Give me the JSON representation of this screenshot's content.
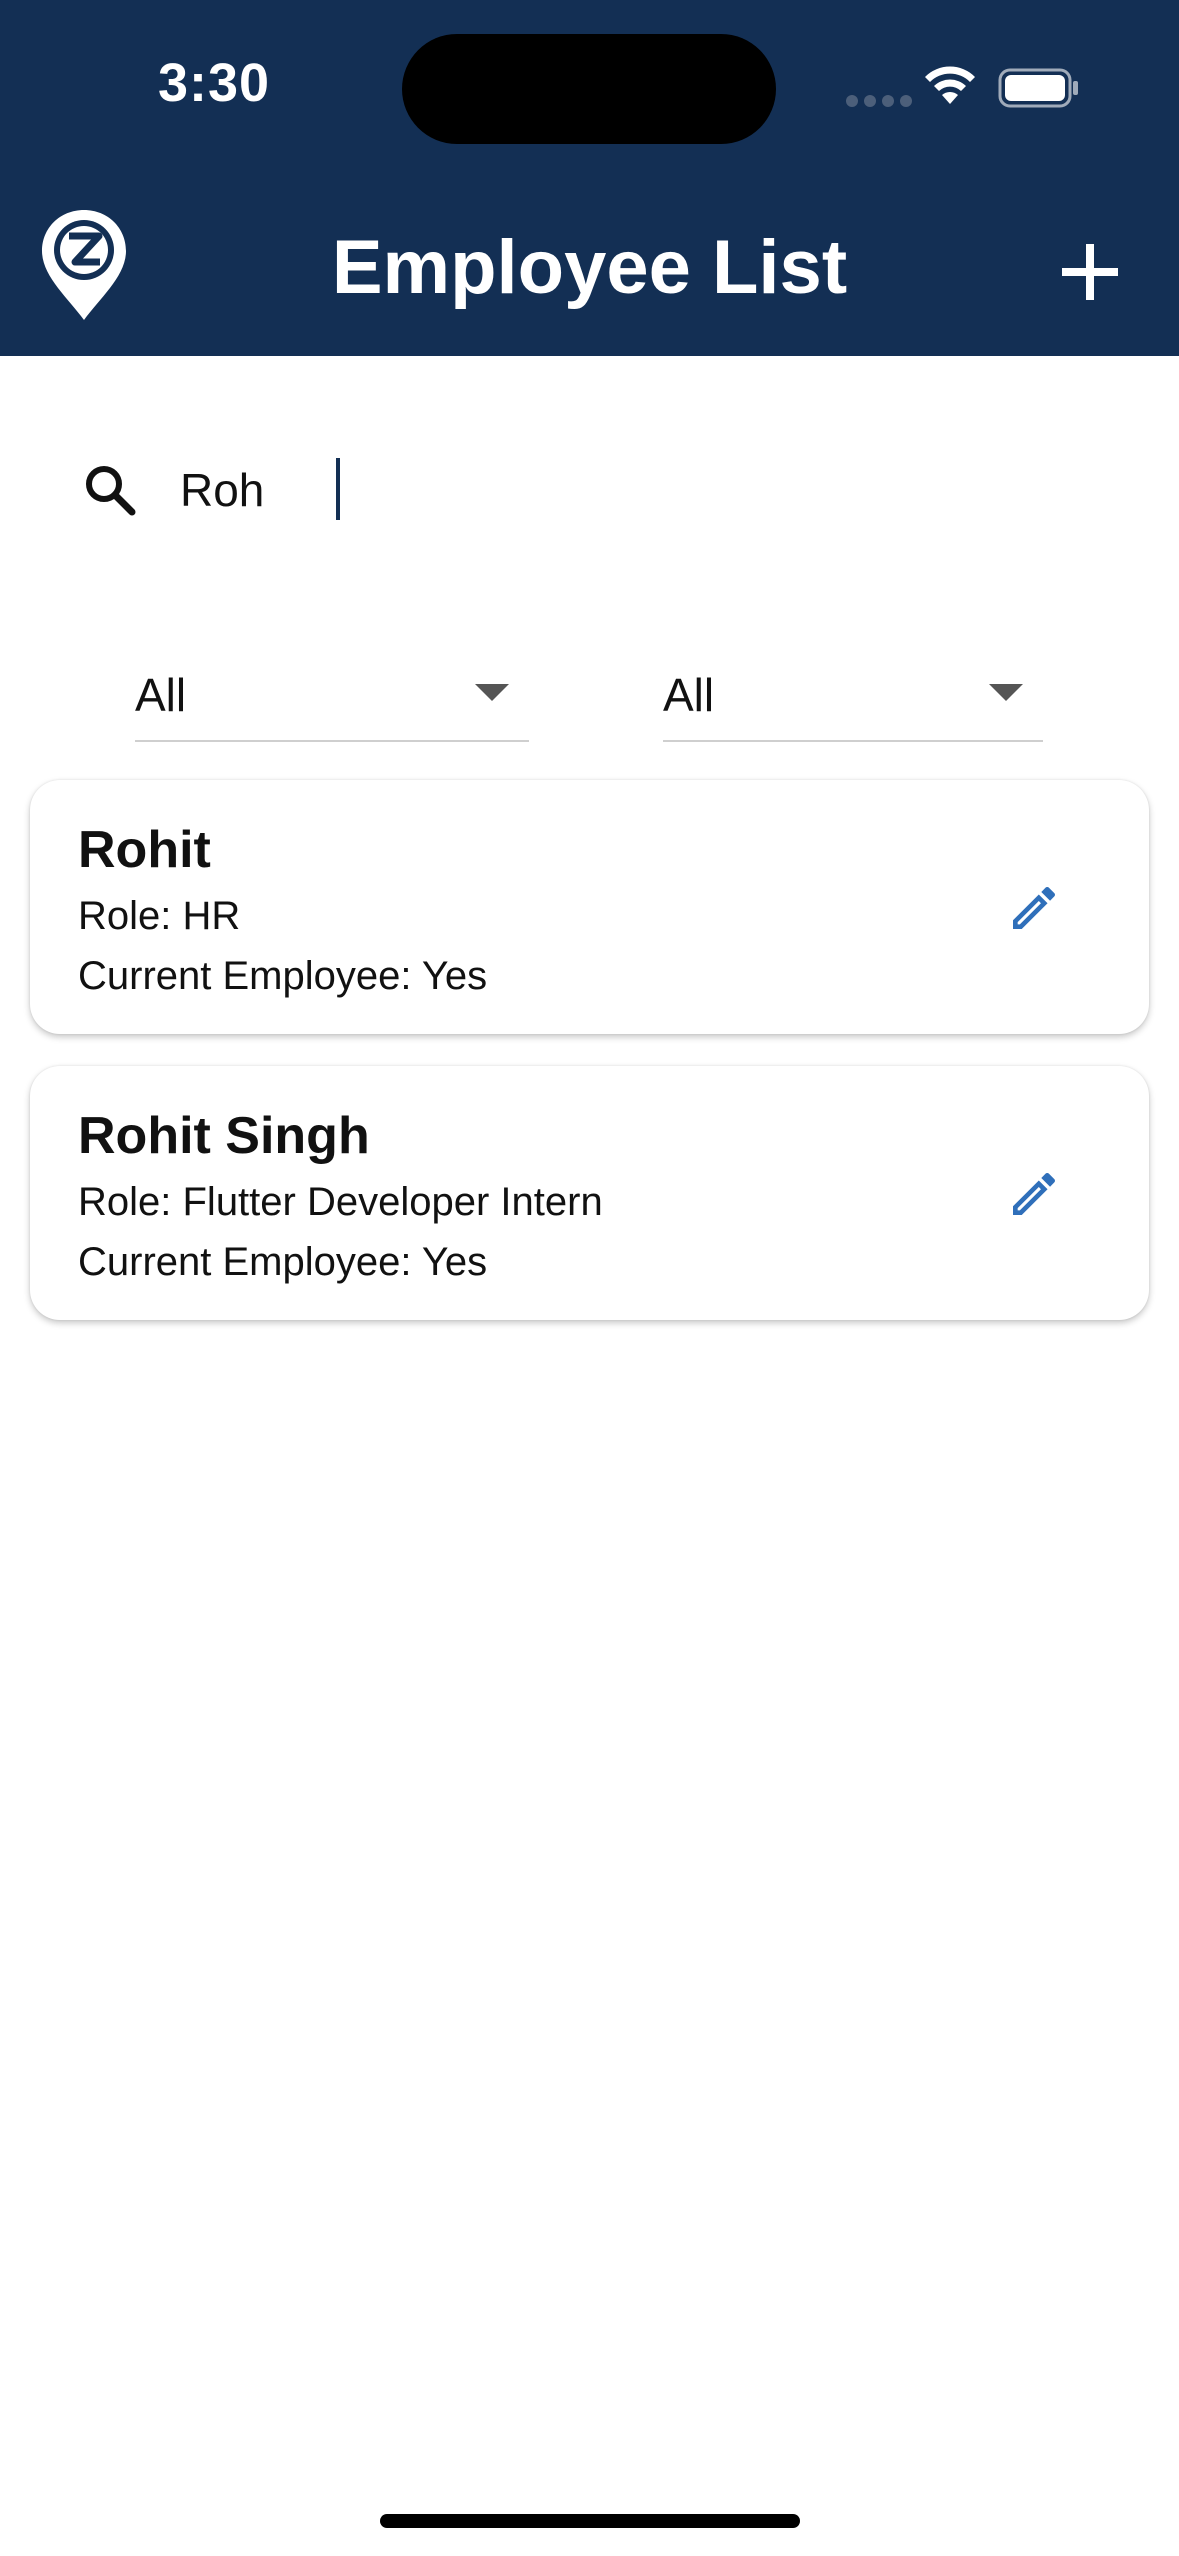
{
  "status_bar": {
    "time": "3:30"
  },
  "app_bar": {
    "title": "Employee List",
    "logo_icon": "location-pin-z-logo",
    "add_icon": "plus-icon"
  },
  "search": {
    "value": "Roh",
    "icon": "search-icon"
  },
  "filters": [
    {
      "value": "All",
      "icon": "caret-down-icon"
    },
    {
      "value": "All",
      "icon": "caret-down-icon"
    }
  ],
  "employees": [
    {
      "name": "Rohit",
      "role": "Role: HR",
      "current": "Current Employee: Yes",
      "icon": "pencil-edit-icon"
    },
    {
      "name": "Rohit Singh",
      "role": "Role: Flutter Developer Intern",
      "current": "Current Employee: Yes",
      "icon": "pencil-edit-icon"
    }
  ],
  "colors": {
    "header_bg": "#132f54",
    "edit_icon": "#2f6fba",
    "text": "#111111"
  }
}
